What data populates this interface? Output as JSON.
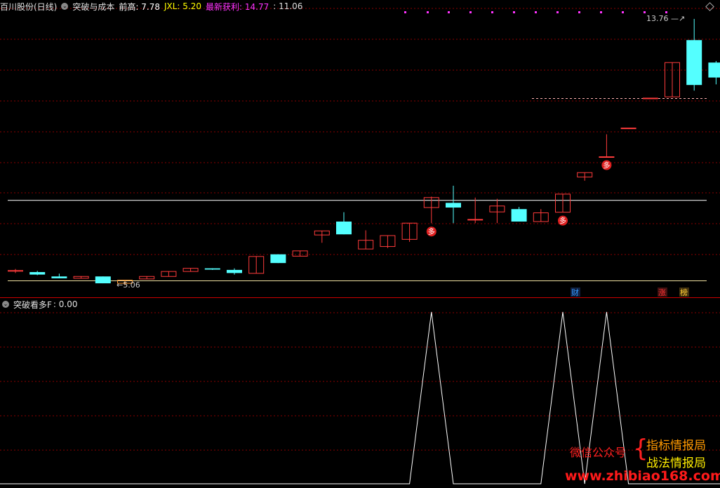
{
  "header_top": {
    "stock_name": "百川股份(日线)",
    "indicator_name": "突破与成本",
    "items": [
      {
        "label": "前高: ",
        "value": "7.78",
        "color": "#ffffff"
      },
      {
        "label": "JXL: ",
        "value": "5.20",
        "color": "#ffff00"
      },
      {
        "label": "最新获利: ",
        "value": "14.77",
        "color": "#ff33ff"
      },
      {
        "label": ": ",
        "value": "11.06",
        "color": "#dddddd"
      }
    ]
  },
  "header_bottom": {
    "indicator_name": "突破看多F",
    "value_text": ": 0.00"
  },
  "annotations": {
    "low_label": "5.06",
    "high_label": "13.76",
    "duo": "多",
    "cai": "财",
    "zhang": "涨",
    "bang": "榜"
  },
  "watermark": {
    "left": "微信公众号",
    "right_top": "指标情报局",
    "right_bottom": "战法情报局",
    "url": "www.zhibiao168.com"
  },
  "colors": {
    "up": "#ff3b3b",
    "down": "#54ffff",
    "grid": "#8b0000",
    "line": "#ffffff"
  },
  "chart_data": {
    "type": "candlestick",
    "lines": {
      "upper": 7.78,
      "lower": 5.2
    },
    "candles": [
      {
        "o": 5.53,
        "h": 5.58,
        "l": 5.45,
        "c": 5.53
      },
      {
        "o": 5.48,
        "h": 5.52,
        "l": 5.38,
        "c": 5.4
      },
      {
        "o": 5.34,
        "h": 5.43,
        "l": 5.28,
        "c": 5.28
      },
      {
        "o": 5.28,
        "h": 5.34,
        "l": 5.28,
        "c": 5.34
      },
      {
        "o": 5.34,
        "h": 5.34,
        "l": 5.12,
        "c": 5.12
      },
      {
        "o": 5.12,
        "h": 5.22,
        "l": 5.06,
        "c": 5.22
      },
      {
        "o": 5.26,
        "h": 5.34,
        "l": 5.26,
        "c": 5.34
      },
      {
        "o": 5.34,
        "h": 5.5,
        "l": 5.34,
        "c": 5.5
      },
      {
        "o": 5.5,
        "h": 5.6,
        "l": 5.5,
        "c": 5.6
      },
      {
        "o": 5.6,
        "h": 5.6,
        "l": 5.55,
        "c": 5.56
      },
      {
        "o": 5.55,
        "h": 5.6,
        "l": 5.4,
        "c": 5.45
      },
      {
        "o": 5.44,
        "h": 5.98,
        "l": 5.44,
        "c": 5.98
      },
      {
        "o": 6.05,
        "h": 6.05,
        "l": 5.77,
        "c": 5.77
      },
      {
        "o": 5.99,
        "h": 6.16,
        "l": 5.99,
        "c": 6.16
      },
      {
        "o": 6.67,
        "h": 6.8,
        "l": 6.42,
        "c": 6.8
      },
      {
        "o": 7.1,
        "h": 7.4,
        "l": 6.69,
        "c": 6.69
      },
      {
        "o": 6.22,
        "h": 6.82,
        "l": 6.22,
        "c": 6.5
      },
      {
        "o": 6.3,
        "h": 6.65,
        "l": 6.25,
        "c": 6.65
      },
      {
        "o": 6.53,
        "h": 7.05,
        "l": 6.45,
        "c": 7.05
      },
      {
        "o": 7.55,
        "h": 7.9,
        "l": 7.05,
        "c": 7.87
      },
      {
        "o": 7.7,
        "h": 8.25,
        "l": 7.05,
        "c": 7.55
      },
      {
        "o": 7.17,
        "h": 7.87,
        "l": 7.05,
        "c": 7.17
      },
      {
        "o": 7.41,
        "h": 7.83,
        "l": 7.05,
        "c": 7.6
      },
      {
        "o": 7.5,
        "h": 7.57,
        "l": 7.1,
        "c": 7.1
      },
      {
        "o": 7.1,
        "h": 7.5,
        "l": 7.1,
        "c": 7.38
      },
      {
        "o": 7.4,
        "h": 7.98,
        "l": 7.4,
        "c": 7.98
      },
      {
        "o": 8.53,
        "h": 8.67,
        "l": 8.41,
        "c": 8.67
      },
      {
        "o": 9.18,
        "h": 9.9,
        "l": 9.18,
        "c": 9.18
      },
      {
        "o": 10.1,
        "h": 10.1,
        "l": 10.1,
        "c": 10.1
      },
      {
        "o": 11.06,
        "h": 11.06,
        "l": 11.06,
        "c": 11.06
      },
      {
        "o": 11.1,
        "h": 12.2,
        "l": 11.1,
        "c": 12.2
      },
      {
        "o": 12.92,
        "h": 13.6,
        "l": 11.3,
        "c": 11.48
      },
      {
        "o": 12.2,
        "h": 12.25,
        "l": 11.5,
        "c": 11.72
      }
    ],
    "signal": [
      0,
      0,
      0,
      0,
      0,
      0,
      0,
      0,
      0,
      0,
      0,
      0,
      0,
      0,
      0,
      0,
      0,
      0,
      0,
      1,
      0,
      0,
      0,
      0,
      0,
      1,
      0,
      1,
      0,
      0,
      0,
      0,
      0
    ],
    "duo_markers": [
      19,
      25,
      27
    ]
  }
}
